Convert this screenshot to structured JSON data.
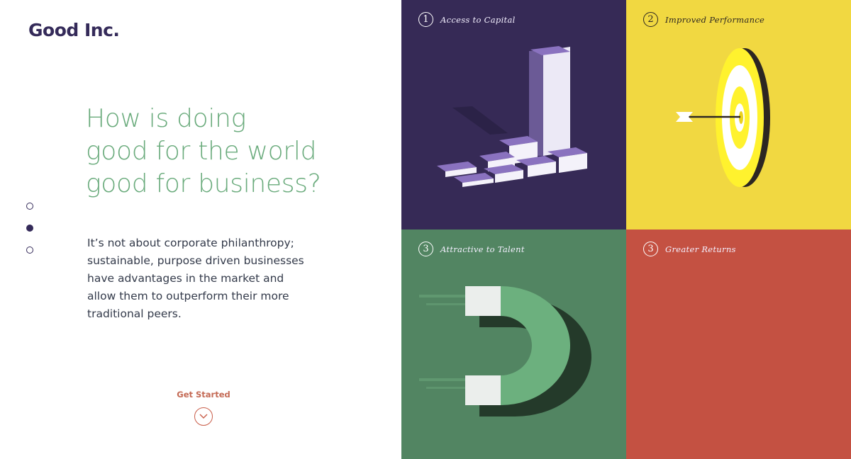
{
  "brand": {
    "logo": "Good Inc."
  },
  "hero": {
    "headline": [
      "How is doing",
      "good for the world",
      "good for business?"
    ],
    "body": [
      "It’s not about corporate philanthropy;",
      "sustainable, purpose driven businesses",
      "have advantages in the market and",
      "allow them to outperform their more",
      "traditional peers."
    ],
    "cta": {
      "label": "Get Started",
      "icon": "chevron-down-icon"
    }
  },
  "pagination": {
    "count": 3,
    "active_index": 1
  },
  "tiles": [
    {
      "number": "1",
      "title": "Access to Capital",
      "color": "#362a56",
      "icon": "bar-chart-icon"
    },
    {
      "number": "2",
      "title": "Improved Performance",
      "color": "#f1d841",
      "icon": "target-icon"
    },
    {
      "number": "3",
      "title": "Attractive to Talent",
      "color": "#528562",
      "icon": "magnet-icon"
    },
    {
      "number": "3",
      "title": "Greater Returns",
      "color": "#c45142",
      "icon": ""
    }
  ]
}
